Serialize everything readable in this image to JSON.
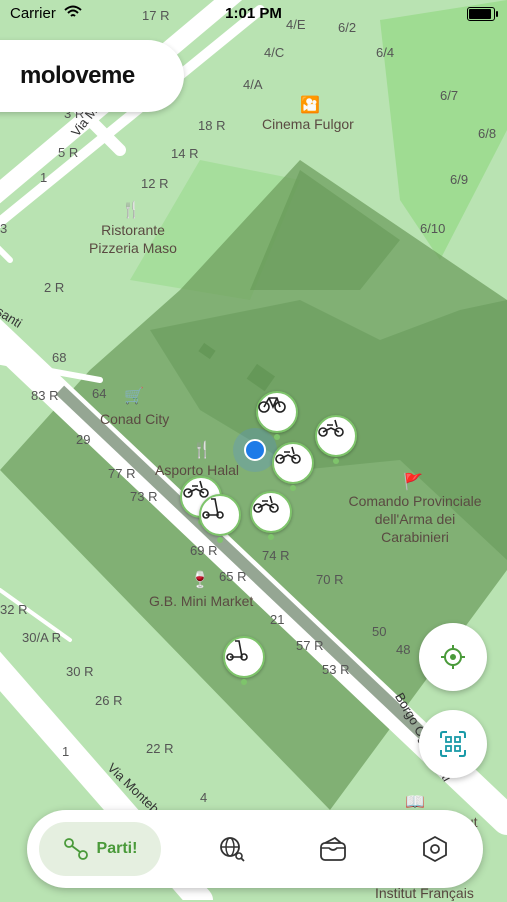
{
  "status_bar": {
    "carrier": "Carrier",
    "time": "1:01 PM",
    "battery_level": 1.0
  },
  "app": {
    "logo": "moloveme"
  },
  "map": {
    "pois": [
      {
        "name": "Cinema Fulgor",
        "icon": "cinema-icon"
      },
      {
        "name": "Ristorante\nPizzeria Maso",
        "icon": "restaurant-icon"
      },
      {
        "name": "Conad City",
        "icon": "shopping-cart-icon"
      },
      {
        "name": "Asporto Halal",
        "icon": "restaurant-icon"
      },
      {
        "name": "Comando Provinciale\ndell'Arma dei\nCarabinieri",
        "icon": "police-icon"
      },
      {
        "name": "G.B. Mini Market",
        "icon": "bottle-icon"
      },
      {
        "name": "Institut Français",
        "icon": "book-icon"
      },
      {
        "name": "tut",
        "icon": ""
      }
    ],
    "streets": [
      {
        "name": "Via Maso Finiguerra"
      },
      {
        "name": "Via Montebello"
      },
      {
        "name": "Borgo Ognissanti"
      },
      {
        "name": "ssanti"
      }
    ],
    "house_numbers": [
      "17 R",
      "6/2",
      "4/E",
      "4/C",
      "6/4",
      "4/A",
      "6/7",
      "18 R",
      "6/8",
      "5 R",
      "14 R",
      "1",
      "6/9",
      "12 R",
      "6/10",
      "3",
      "2 R",
      "68",
      "83 R",
      "64",
      "29",
      "77 R",
      "73 R",
      "69 R",
      "65 R",
      "74 R",
      "70 R",
      "21",
      "50",
      "57 R",
      "48",
      "53 R",
      "32 R",
      "30/A R",
      "30 R",
      "26 R",
      "1",
      "22 R",
      "4",
      "3 R"
    ],
    "vehicles": [
      {
        "type": "bicycle",
        "icon": "bicycle-icon"
      },
      {
        "type": "moped",
        "icon": "moped-icon"
      },
      {
        "type": "moped",
        "icon": "moped-icon"
      },
      {
        "type": "moped",
        "icon": "moped-icon"
      },
      {
        "type": "kick-scooter",
        "icon": "kick-scooter-icon"
      },
      {
        "type": "moped",
        "icon": "moped-icon"
      },
      {
        "type": "kick-scooter",
        "icon": "kick-scooter-icon"
      }
    ]
  },
  "fabs": {
    "locate": {
      "icon": "crosshair-icon"
    },
    "scan": {
      "icon": "qr-scan-icon"
    }
  },
  "nav": {
    "items": [
      {
        "label": "Parti!",
        "icon": "route-icon",
        "active": true
      },
      {
        "label": "",
        "icon": "globe-search-icon"
      },
      {
        "label": "",
        "icon": "wallet-icon"
      },
      {
        "label": "",
        "icon": "settings-hexagon-icon"
      }
    ]
  },
  "colors": {
    "accent": "#4a9a3a",
    "map_bg": "#b9e3b2",
    "zone_fill": "#6f9f5f",
    "pin_border": "#7ec46b",
    "user_dot": "#1e7be8"
  }
}
